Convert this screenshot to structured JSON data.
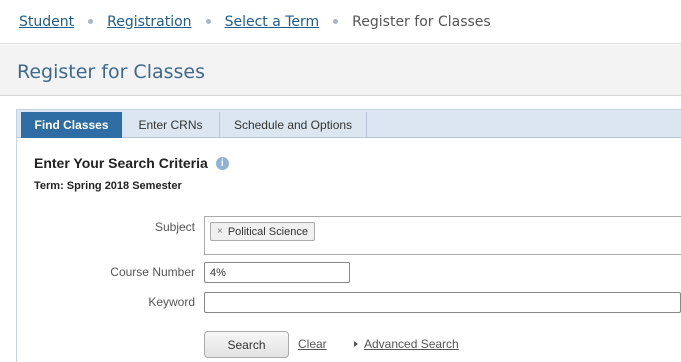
{
  "breadcrumb": {
    "items": [
      "Student",
      "Registration",
      "Select a Term"
    ],
    "current": "Register for Classes"
  },
  "page": {
    "title": "Register for Classes"
  },
  "tabs": [
    {
      "label": "Find Classes",
      "active": true
    },
    {
      "label": "Enter CRNs",
      "active": false
    },
    {
      "label": "Schedule and Options",
      "active": false
    }
  ],
  "search": {
    "heading": "Enter Your Search Criteria",
    "term": "Term: Spring 2018 Semester",
    "subject_label": "Subject",
    "subject_chip": "Political Science",
    "subject_chip_remove": "×",
    "course_label": "Course Number",
    "course_value": "4%",
    "keyword_label": "Keyword",
    "keyword_value": "",
    "search_button": "Search",
    "clear_link": "Clear",
    "advanced_link": "Advanced Search"
  },
  "icons": {
    "info": "info-icon"
  },
  "colors": {
    "accent": "#2e6da4",
    "link": "#1f5c8b",
    "tab_bar": "#dbe6f0"
  }
}
